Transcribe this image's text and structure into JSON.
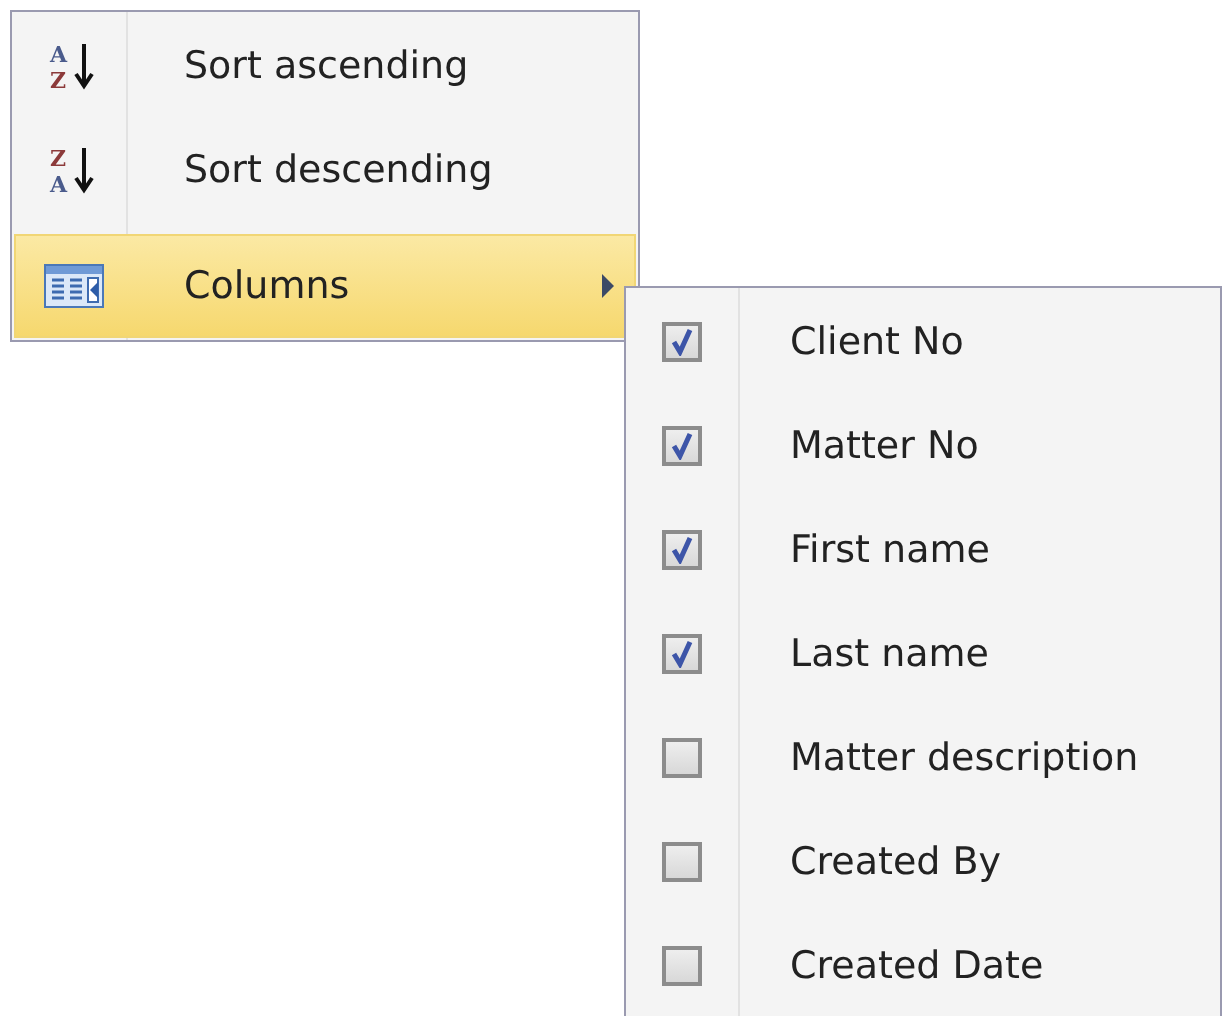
{
  "menu": {
    "items": [
      {
        "kind": "sort",
        "label": "Sort ascending",
        "icon_letters": [
          "A",
          "Z"
        ],
        "selected": false
      },
      {
        "kind": "sort",
        "label": "Sort descending",
        "icon_letters": [
          "Z",
          "A"
        ],
        "selected": false
      },
      {
        "kind": "submenu",
        "label": "Columns",
        "selected": true
      }
    ]
  },
  "columns_submenu": {
    "items": [
      {
        "label": "Client No",
        "checked": true
      },
      {
        "label": "Matter No",
        "checked": true
      },
      {
        "label": "First name",
        "checked": true
      },
      {
        "label": "Last name",
        "checked": true
      },
      {
        "label": "Matter description",
        "checked": false
      },
      {
        "label": "Created By",
        "checked": false
      },
      {
        "label": "Created Date",
        "checked": false
      }
    ]
  }
}
